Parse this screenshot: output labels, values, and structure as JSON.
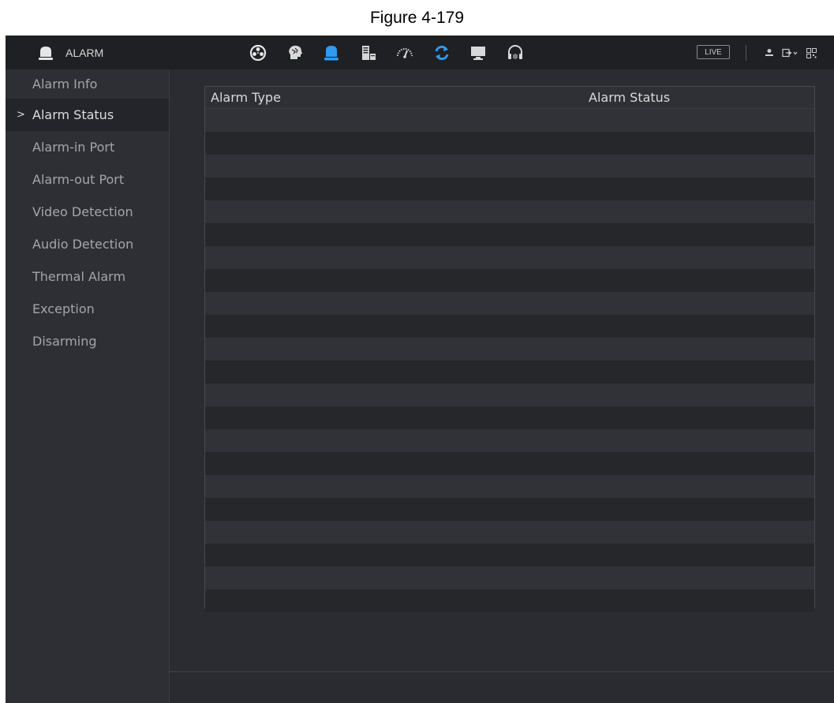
{
  "caption": "Figure 4-179",
  "topbar": {
    "title": "ALARM",
    "title_icon": "alarm-bell-icon",
    "nav": [
      {
        "icon": "camera-reel-icon",
        "active": false
      },
      {
        "icon": "ai-brain-icon",
        "active": false
      },
      {
        "icon": "alarm-bell-icon",
        "active": true
      },
      {
        "icon": "storage-icon",
        "active": false
      },
      {
        "icon": "speedometer-icon",
        "active": false
      },
      {
        "icon": "refresh-icon",
        "active": false
      },
      {
        "icon": "monitor-icon",
        "active": false
      },
      {
        "icon": "headset-icon",
        "active": false
      }
    ],
    "live_label": "LIVE",
    "right_icons": [
      "user-icon",
      "logout-icon",
      "qr-code-icon"
    ]
  },
  "sidebar": {
    "items": [
      {
        "label": "Alarm Info",
        "active": false
      },
      {
        "label": "Alarm Status",
        "active": true
      },
      {
        "label": "Alarm-in Port",
        "active": false
      },
      {
        "label": "Alarm-out Port",
        "active": false
      },
      {
        "label": "Video Detection",
        "active": false
      },
      {
        "label": "Audio Detection",
        "active": false
      },
      {
        "label": "Thermal Alarm",
        "active": false
      },
      {
        "label": "Exception",
        "active": false
      },
      {
        "label": "Disarming",
        "active": false
      }
    ]
  },
  "table": {
    "columns": [
      "Alarm Type",
      "Alarm Status"
    ],
    "rows": [
      [
        "",
        ""
      ],
      [
        "",
        ""
      ],
      [
        "",
        ""
      ],
      [
        "",
        ""
      ],
      [
        "",
        ""
      ],
      [
        "",
        ""
      ],
      [
        "",
        ""
      ],
      [
        "",
        ""
      ],
      [
        "",
        ""
      ],
      [
        "",
        ""
      ],
      [
        "",
        ""
      ],
      [
        "",
        ""
      ],
      [
        "",
        ""
      ],
      [
        "",
        ""
      ],
      [
        "",
        ""
      ],
      [
        "",
        ""
      ],
      [
        "",
        ""
      ],
      [
        "",
        ""
      ],
      [
        "",
        ""
      ],
      [
        "",
        ""
      ],
      [
        "",
        ""
      ],
      [
        "",
        ""
      ]
    ]
  },
  "colors": {
    "accent": "#2f9bf2",
    "background": "#2b2c31",
    "topbar": "#1f2024"
  }
}
